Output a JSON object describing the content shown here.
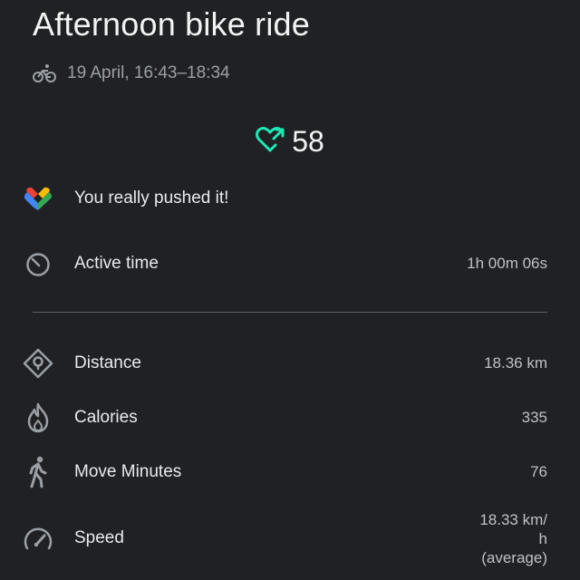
{
  "header": {
    "title": "Afternoon bike ride",
    "activity_icon": "bicycle-icon",
    "date_time": "19 April, 16:43–18:34"
  },
  "heart_points": {
    "icon": "heart-points-icon",
    "value": "58",
    "color": "#1de9b6"
  },
  "summary": {
    "icon": "google-fit-heart-icon",
    "message": "You really pushed it!"
  },
  "active_time": {
    "icon": "timer-icon",
    "label": "Active time",
    "value": "1h 00m 06s"
  },
  "stats": [
    {
      "icon": "location-diamond-icon",
      "label": "Distance",
      "value": "18.36 km"
    },
    {
      "icon": "flame-icon",
      "label": "Calories",
      "value": "335"
    },
    {
      "icon": "walking-person-icon",
      "label": "Move Minutes",
      "value": "76"
    },
    {
      "icon": "speedometer-icon",
      "label": "Speed",
      "value_line1": "18.33 km/",
      "value_line2": "h",
      "value_line3": "(average)"
    }
  ],
  "colors": {
    "background": "#202124",
    "text_primary": "#e8eaed",
    "text_secondary": "#9aa0a6",
    "divider": "#5f6368",
    "heart_accent": "#1de9b6"
  }
}
